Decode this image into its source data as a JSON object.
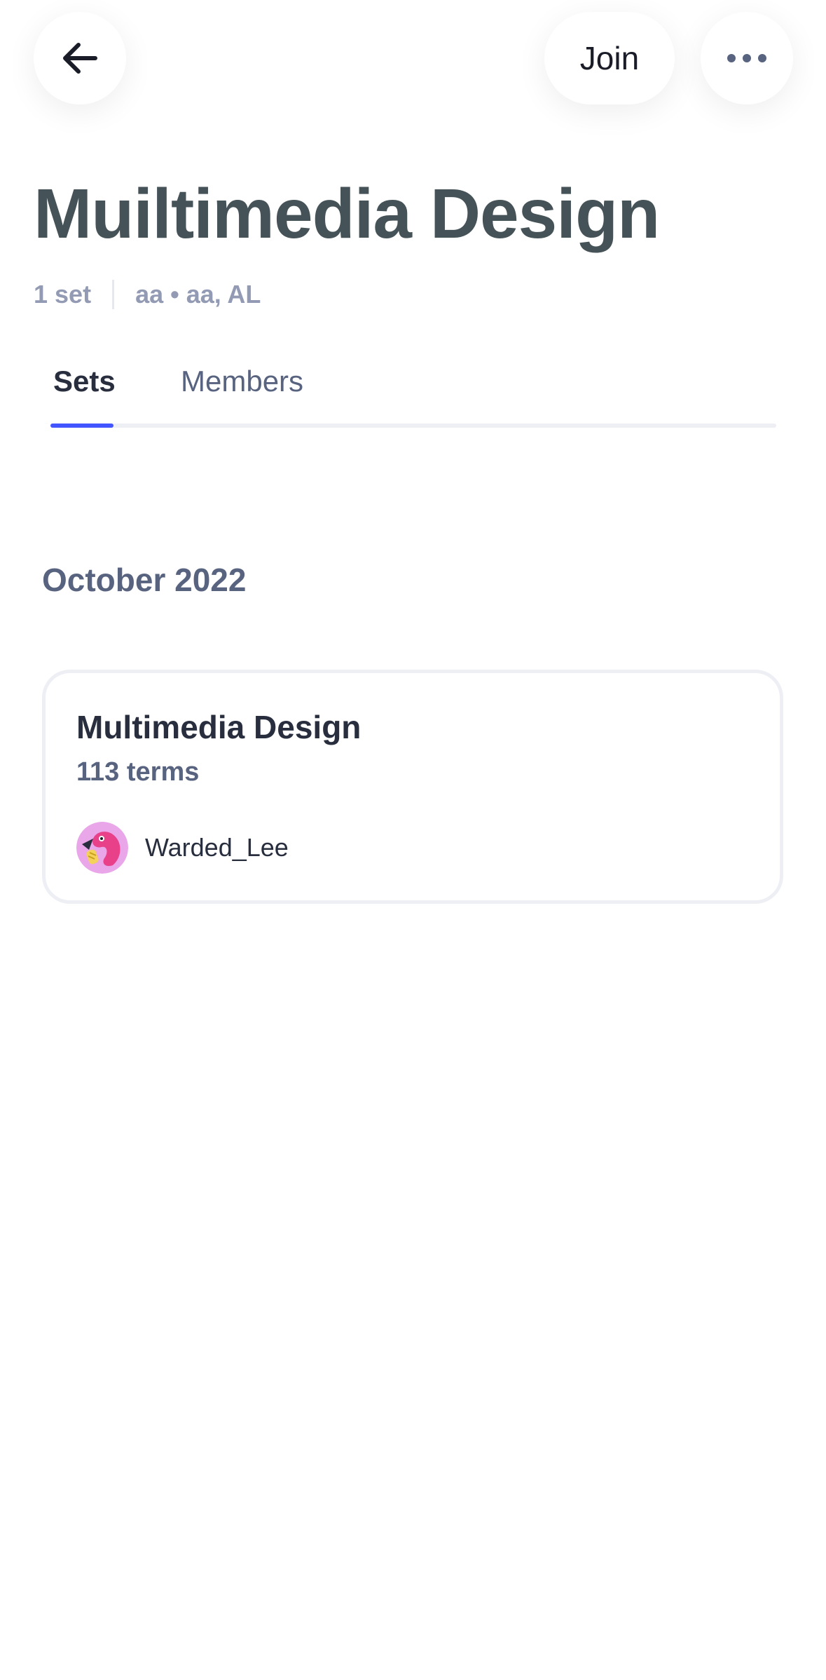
{
  "header": {
    "back_icon": "arrow-left-icon",
    "join_label": "Join",
    "more_icon": "more-horizontal-icon"
  },
  "class": {
    "title": "Muiltimedia Design",
    "set_count": "1 set",
    "school": "aa • aa, AL"
  },
  "tabs": [
    {
      "label": "Sets",
      "active": true
    },
    {
      "label": "Members",
      "active": false
    }
  ],
  "sets_section": {
    "heading": "October 2022",
    "cards": [
      {
        "title": "Multimedia Design",
        "terms": "113 terms",
        "creator": "Warded_Lee",
        "avatar_icon": "flamingo-avatar-icon"
      }
    ]
  },
  "colors": {
    "accent": "#4255ff",
    "title": "#455358",
    "muted": "#939bb4",
    "secondary": "#586380",
    "border": "#edeff4"
  }
}
